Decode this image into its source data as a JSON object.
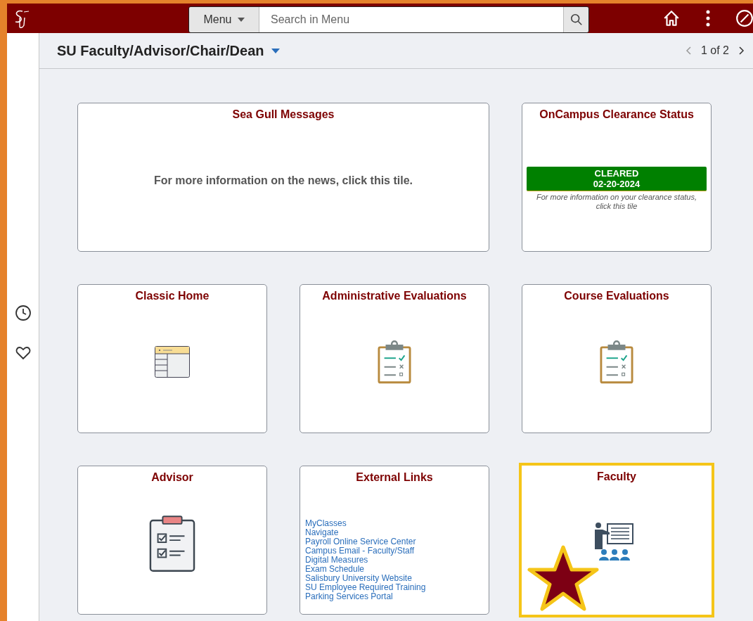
{
  "header": {
    "menu_button": "Menu",
    "search": {
      "placeholder": "Search in Menu"
    }
  },
  "page_title": "SU Faculty/Advisor/Chair/Dean",
  "pager": "1 of 2",
  "tiles": [
    {
      "kind": "message",
      "title": "Sea Gull Messages",
      "text": "For more information on the news, click this tile.",
      "highlighted": false,
      "starred": false
    },
    {
      "kind": "clearance",
      "title": "OnCampus Clearance Status",
      "status": "CLEARED",
      "date": "02-20-2024",
      "text": "For more information on your clearance status, click this tile",
      "highlighted": false,
      "starred": false
    },
    {
      "kind": "table",
      "title": "Classic Home",
      "highlighted": false,
      "starred": false
    },
    {
      "kind": "clipboard",
      "title": "Administrative Evaluations",
      "highlighted": false,
      "starred": false
    },
    {
      "kind": "clipboard",
      "title": "Course Evaluations",
      "highlighted": false,
      "starred": false
    },
    {
      "kind": "checklist",
      "title": "Advisor",
      "highlighted": false,
      "starred": false
    },
    {
      "kind": "links",
      "title": "External Links",
      "links": [
        "MyClasses",
        "Navigate",
        "Payroll Online Service Center",
        "Campus Email - Faculty/Staff",
        "Digital Measures",
        "Exam Schedule",
        "Salisbury University Website",
        "SU Employee Required Training",
        "Parking Services Portal"
      ],
      "highlighted": false,
      "starred": false
    },
    {
      "kind": "presenter",
      "title": "Faculty",
      "highlighted": true,
      "starred": true
    }
  ]
}
